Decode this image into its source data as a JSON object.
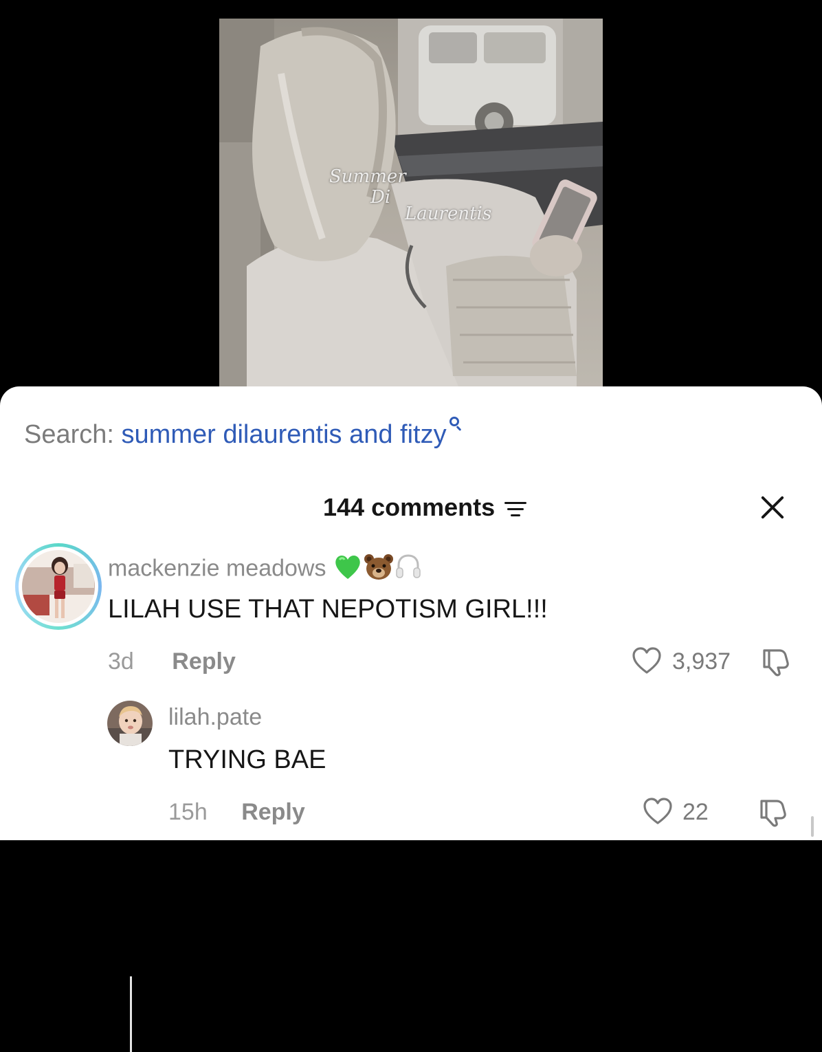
{
  "video": {
    "watermark": [
      "Summer",
      "Di",
      "Laurentis"
    ]
  },
  "search": {
    "label": "Search:",
    "query": "summer dilaurentis and fitzy"
  },
  "comments_header": {
    "count_label": "144 comments"
  },
  "comments": [
    {
      "username": "mackenzie meadows",
      "emojis": [
        "green-heart",
        "bear-face",
        "headphones"
      ],
      "text": "LILAH USE THAT NEPOTISM GIRL!!!",
      "time": "3d",
      "reply_label": "Reply",
      "likes": "3,937"
    }
  ],
  "replies": [
    {
      "username": "lilah.pate",
      "text": "TRYING BAE",
      "time": "15h",
      "reply_label": "Reply",
      "likes": "22"
    }
  ],
  "colors": {
    "search_query": "#2f5bb7",
    "avatar_ring": "#5ad8c8"
  }
}
